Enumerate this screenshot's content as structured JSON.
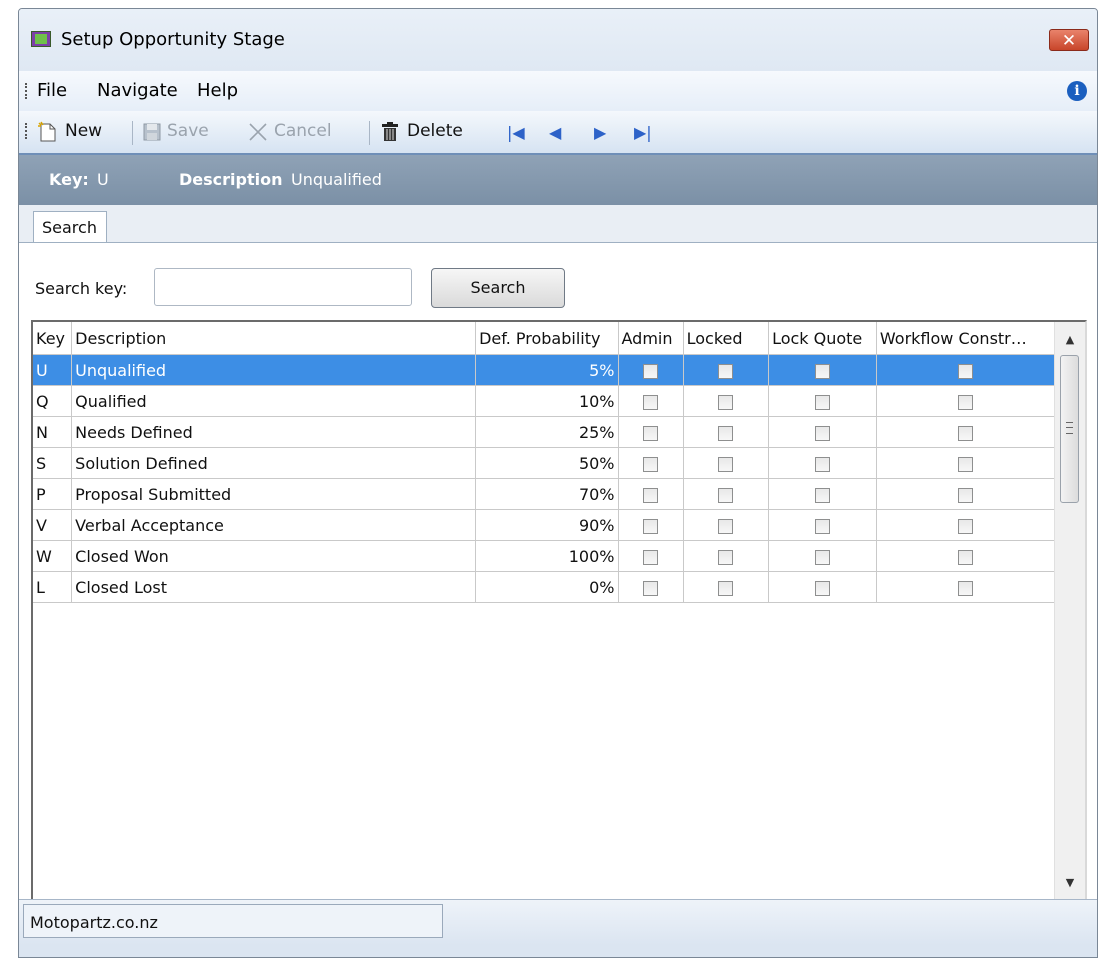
{
  "window": {
    "title": "Setup Opportunity Stage",
    "close_label": "✕"
  },
  "menu": [
    "File",
    "Navigate",
    "Help"
  ],
  "toolbar": {
    "new_label": "New",
    "save_label": "Save",
    "cancel_label": "Cancel",
    "delete_label": "Delete",
    "nav": [
      "first-record-icon",
      "previous-record-icon",
      "next-record-icon",
      "last-record-icon"
    ]
  },
  "keybar": {
    "key_label": "Key:",
    "key_value": "U",
    "desc_label": "Description",
    "desc_value": "Unqualified"
  },
  "tabs": [
    "Search"
  ],
  "search": {
    "label": "Search key:",
    "value": "",
    "button_label": "Search"
  },
  "grid": {
    "columns": [
      "Key",
      "Description",
      "Def. Probability",
      "Admin",
      "Locked",
      "Lock Quote",
      "Workflow Constr…"
    ],
    "rows": [
      {
        "key": "U",
        "description": "Unqualified",
        "probability": "5%",
        "admin": false,
        "locked": false,
        "lock_quote": false,
        "workflow": false,
        "selected": true
      },
      {
        "key": "Q",
        "description": "Qualified",
        "probability": "10%",
        "admin": false,
        "locked": false,
        "lock_quote": false,
        "workflow": false,
        "selected": false
      },
      {
        "key": "N",
        "description": "Needs Defined",
        "probability": "25%",
        "admin": false,
        "locked": false,
        "lock_quote": false,
        "workflow": false,
        "selected": false
      },
      {
        "key": "S",
        "description": "Solution Defined",
        "probability": "50%",
        "admin": false,
        "locked": false,
        "lock_quote": false,
        "workflow": false,
        "selected": false
      },
      {
        "key": "P",
        "description": "Proposal Submitted",
        "probability": "70%",
        "admin": false,
        "locked": false,
        "lock_quote": false,
        "workflow": false,
        "selected": false
      },
      {
        "key": "V",
        "description": "Verbal Acceptance",
        "probability": "90%",
        "admin": false,
        "locked": false,
        "lock_quote": false,
        "workflow": false,
        "selected": false
      },
      {
        "key": "W",
        "description": "Closed Won",
        "probability": "100%",
        "admin": false,
        "locked": false,
        "lock_quote": false,
        "workflow": false,
        "selected": false
      },
      {
        "key": "L",
        "description": "Closed Lost",
        "probability": "0%",
        "admin": false,
        "locked": false,
        "lock_quote": false,
        "workflow": false,
        "selected": false
      }
    ]
  },
  "status": {
    "company": "Motopartz.co.nz"
  },
  "colors": {
    "selection": "#3d8ee5",
    "keybar": "#8397ac",
    "toolbar_border": "#6f8fb8"
  }
}
